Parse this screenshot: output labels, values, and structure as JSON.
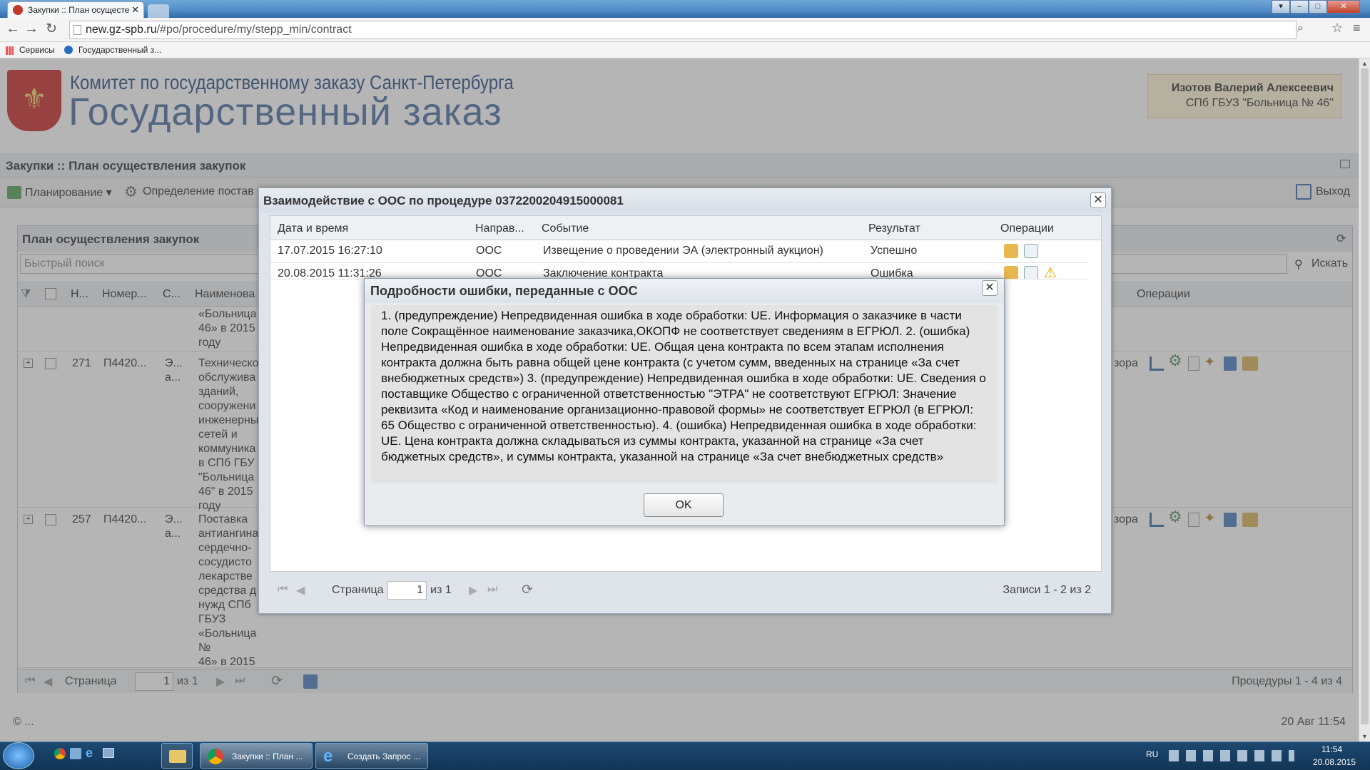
{
  "browser": {
    "tab_title": "Закупки :: План осущесте",
    "url_host": "new.gz-spb.ru",
    "url_path": "/#po/procedure/my/stepp_min/contract",
    "bookmarks": [
      "Сервисы",
      "Государственный з..."
    ]
  },
  "header": {
    "org_line1": "Комитет по государственному заказу Санкт-Петербурга",
    "org_line2": "Государственный заказ",
    "user_name": "Изотов Валерий Алексеевич",
    "user_org": "СПб ГБУЗ \"Больница № 46\""
  },
  "section_title": "Закупки :: План осуществления закупок",
  "toolbar": {
    "planning": "Планирование",
    "determination": "Определение постав",
    "exit": "Выход"
  },
  "panel": {
    "title": "План осуществления закупок",
    "search_placeholder": "Быстрый поиск",
    "search_button": "Искать",
    "columns": [
      "Н...",
      "Номер...",
      "С...",
      "Наименова",
      "Операции"
    ],
    "rows": [
      {
        "num": "",
        "code": "",
        "status": "",
        "name": "«Больница\n46» в 2015\nгоду",
        "stage": ""
      },
      {
        "num": "271",
        "code": "П4420...",
        "status": "Э...\nа...",
        "name": "Техническо\nобслужива\nзданий,\nсооружени\nинженерны\nсетей и\nкоммуника\nв СПб ГБУ\n\"Больница\n46\" в 2015\nгоду",
        "stage": "зора"
      },
      {
        "num": "257",
        "code": "П4420...",
        "status": "Э...\nа...",
        "name": "Поставка\nантиангина\nсердечно-\nсосудисто\nлекарстве\nсредства д\nнужд СПб\nГБУЗ\n«Больница №\n46» в 2015\nгоду",
        "stage": "зора"
      }
    ],
    "pager": {
      "page_label": "Страница",
      "page_value": "1",
      "of_label": "из 1",
      "summary": "Процедуры 1 - 4 из 4"
    }
  },
  "footer": {
    "copyright": "© ...",
    "datetime": "20 Авг 11:54"
  },
  "dialog_ooc": {
    "title": "Взаимодействие с ООС по процедуре 0372200204915000081",
    "columns": [
      "Дата и время",
      "Направ...",
      "Событие",
      "Результат",
      "Операции"
    ],
    "rows": [
      {
        "date": "17.07.2015 16:27:10",
        "direction": "ООС",
        "event": "Извещение о проведении ЭА (электронный аукцион)",
        "result": "Успешно"
      },
      {
        "date": "20.08.2015 11:31:26",
        "direction": "ООС",
        "event": "Заключение контракта",
        "result": "Ошибка"
      }
    ],
    "pager": {
      "page_label": "Страница",
      "page_value": "1",
      "of_label": "из 1",
      "summary": "Записи 1 - 2 из 2"
    }
  },
  "dialog_error": {
    "title": "Подробности ошибки, переданные с ООС",
    "message": "1. (предупреждение) Непредвиденная ошибка в ходе обработки: UE. Информация о заказчике в части поле Сокращённое наименование заказчика,ОКОПФ не соответствует сведениям в ЕГРЮЛ. 2. (ошибка) Непредвиденная ошибка в ходе обработки: UE. Общая цена контракта по всем этапам исполнения контракта должна быть равна общей цене контракта (с учетом сумм, введенных на странице «За счет внебюджетных средств») 3. (предупреждение) Непредвиденная ошибка в ходе обработки: UE. Сведения о поставщике Общество с ограниченной ответственностью \"ЭТРА\" не соответствуют ЕГРЮЛ: Значение реквизита «Код и наименование организационно-правовой формы» не соответствует ЕГРЮЛ (в ЕГРЮЛ: 65 Общество с ограниченной ответственностью). 4. (ошибка) Непредвиденная ошибка в ходе обработки: UE. Цена контракта должна складываться из суммы контракта, указанной на странице «За счет бюджетных средств», и суммы контракта, указанной на странице «За счет внебюджетных средств»",
    "ok_label": "OK"
  },
  "taskbar": {
    "buttons": [
      "Закупки :: План ...",
      "Создать Запрос ..."
    ],
    "lang": "RU",
    "time": "11:54",
    "date": "20.08.2015"
  },
  "colors": {
    "accent": "#2b4f86",
    "overlay": "#5a5a5a",
    "taskbar": "#123556"
  }
}
